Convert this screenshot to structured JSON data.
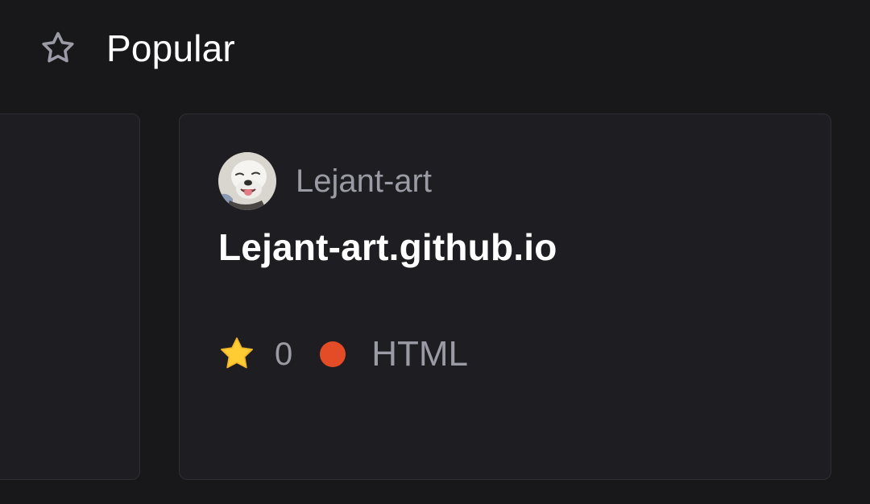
{
  "section": {
    "icon": "star-outline-icon",
    "title": "Popular"
  },
  "repo_card": {
    "owner": {
      "avatar": "dog-avatar",
      "name": "Lejant-art"
    },
    "repo_name": "Lejant-art.github.io",
    "stars": {
      "icon": "star-filled-icon",
      "count": "0"
    },
    "language": {
      "name": "HTML",
      "color": "#e34c26"
    }
  },
  "colors": {
    "background": "#18181b",
    "card_background": "#1e1e22",
    "card_border": "#2e2e33",
    "muted_text": "#9b9ba6",
    "star_yellow": "#ffcc33"
  }
}
